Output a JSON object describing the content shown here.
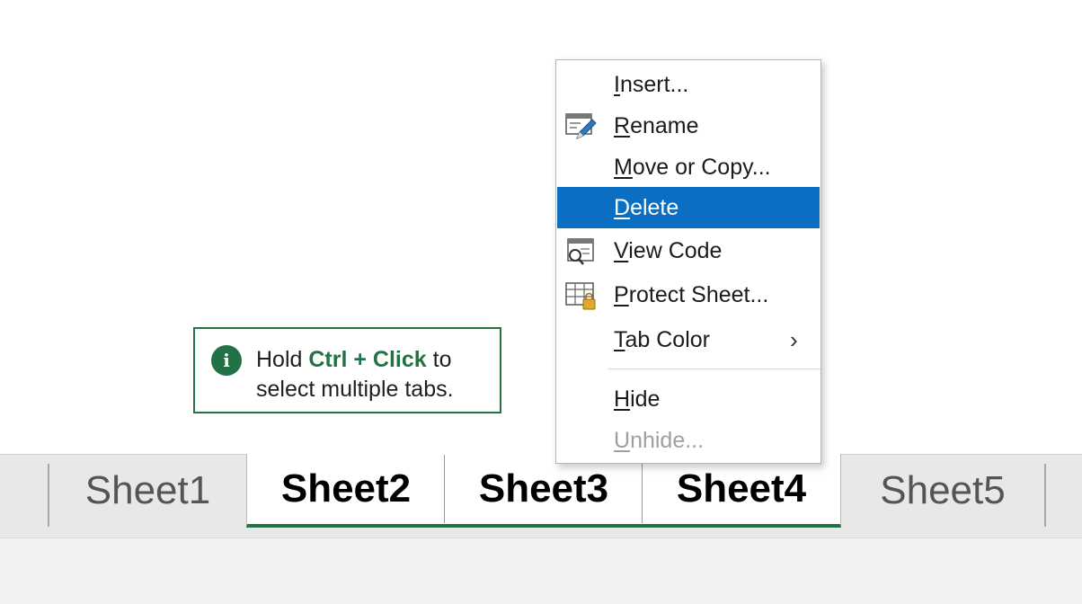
{
  "tip": {
    "icon": "info-icon",
    "prefix": "Hold ",
    "key_text": "Ctrl + Click",
    "suffix": " to",
    "line2": "select multiple tabs."
  },
  "sheet_tabs": [
    {
      "label": "Sheet1",
      "selected": false
    },
    {
      "label": "Sheet2",
      "selected": true
    },
    {
      "label": "Sheet3",
      "selected": true
    },
    {
      "label": "Sheet4",
      "selected": true
    },
    {
      "label": "Sheet5",
      "selected": false
    }
  ],
  "context_menu": {
    "items": [
      {
        "accel": "I",
        "rest": "nsert...",
        "icon": null,
        "state": "normal"
      },
      {
        "accel": "R",
        "rest": "ename",
        "icon": "rename-icon",
        "state": "normal"
      },
      {
        "accel": "M",
        "rest": "ove or Copy...",
        "icon": null,
        "state": "normal"
      },
      {
        "accel": "D",
        "rest": "elete",
        "icon": null,
        "state": "highlighted"
      },
      {
        "accel": "V",
        "rest": "iew Code",
        "icon": "view-code-icon",
        "state": "normal"
      },
      {
        "accel": "P",
        "rest": "rotect Sheet...",
        "icon": "protect-sheet-icon",
        "state": "normal"
      },
      {
        "accel": "T",
        "rest": "ab Color",
        "icon": null,
        "state": "normal",
        "submenu_arrow": "›"
      },
      {
        "accel": "H",
        "rest": "ide",
        "icon": null,
        "state": "normal"
      },
      {
        "accel": "U",
        "rest": "nhide...",
        "icon": null,
        "state": "disabled"
      }
    ]
  },
  "colors": {
    "accent_green": "#217346",
    "highlight_blue": "#0a6fc2",
    "tab_bar_bg": "#e8e8e8"
  }
}
